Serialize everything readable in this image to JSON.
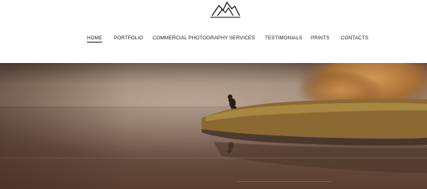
{
  "header": {
    "logo_icon": "mountains-logo-icon"
  },
  "nav": {
    "items": [
      {
        "label": "HOME",
        "active": true
      },
      {
        "label": "PORTFOLIO",
        "active": false
      },
      {
        "label": "COMMERCIAL PHOTOGRAPHY",
        "active": false
      },
      {
        "label": "SERVICES",
        "active": false
      },
      {
        "label": "TESTIMONIALS",
        "active": false
      },
      {
        "label": "PRINTS",
        "active": false
      },
      {
        "label": "CONTACTS",
        "active": false
      }
    ]
  },
  "hero": {
    "subject": "dog-on-misty-lakeshore-photo",
    "colors": {
      "sky": "#8e7b6a",
      "water": "#6e5446",
      "grass": "#9a7a3a",
      "foliage": "#b57a3a"
    }
  }
}
